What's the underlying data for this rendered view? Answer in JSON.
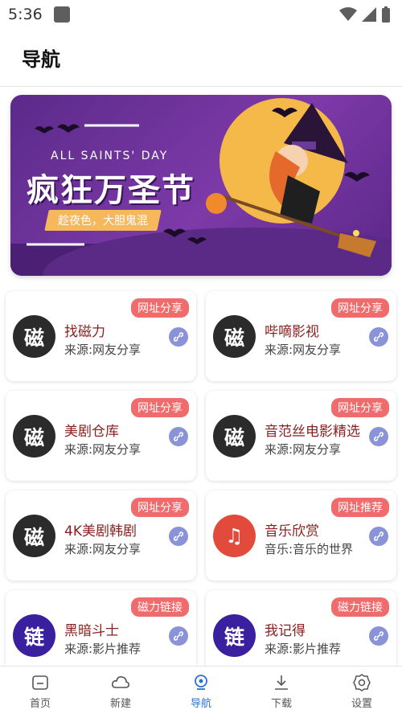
{
  "status_bar": {
    "time": "5:36"
  },
  "header": {
    "title": "导航"
  },
  "banner": {
    "subtitle": "ALL SAINTS' DAY",
    "title": "疯狂万圣节",
    "tagline": "趁夜色，大胆鬼混"
  },
  "cards": [
    {
      "name": "找磁力",
      "source": "来源:网友分享",
      "badge": "网址分享",
      "avatar": "磁",
      "avatar_color": "#2b2b2b"
    },
    {
      "name": "哔嘀影视",
      "source": "来源:网友分享",
      "badge": "网址分享",
      "avatar": "磁",
      "avatar_color": "#2b2b2b"
    },
    {
      "name": "美剧仓库",
      "source": "来源:网友分享",
      "badge": "网址分享",
      "avatar": "磁",
      "avatar_color": "#2b2b2b"
    },
    {
      "name": "音范丝电影精选",
      "source": "来源:网友分享",
      "badge": "网址分享",
      "avatar": "磁",
      "avatar_color": "#2b2b2b"
    },
    {
      "name": "4K美剧韩剧",
      "source": "来源:网友分享",
      "badge": "网址分享",
      "avatar": "磁",
      "avatar_color": "#2b2b2b"
    },
    {
      "name": "音乐欣赏",
      "source": "音乐:音乐的世界",
      "badge": "网址推荐",
      "avatar": "♫",
      "avatar_color": "#e24a3b"
    },
    {
      "name": "黑暗斗士",
      "source": "来源:影片推荐",
      "badge": "磁力链接",
      "avatar": "链",
      "avatar_color": "#3a1f9e"
    },
    {
      "name": "我记得",
      "source": "来源:影片推荐",
      "badge": "磁力链接",
      "avatar": "链",
      "avatar_color": "#3a1f9e"
    }
  ],
  "bottom_nav": [
    {
      "label": "首页",
      "icon": "home-icon"
    },
    {
      "label": "新建",
      "icon": "cloud-icon"
    },
    {
      "label": "导航",
      "icon": "compass-icon",
      "active": true
    },
    {
      "label": "下载",
      "icon": "download-icon"
    },
    {
      "label": "设置",
      "icon": "gear-icon"
    }
  ],
  "colors": {
    "accent": "#2b6fd8",
    "badge": "#f06b6b",
    "card_title": "#8a1f1f"
  }
}
